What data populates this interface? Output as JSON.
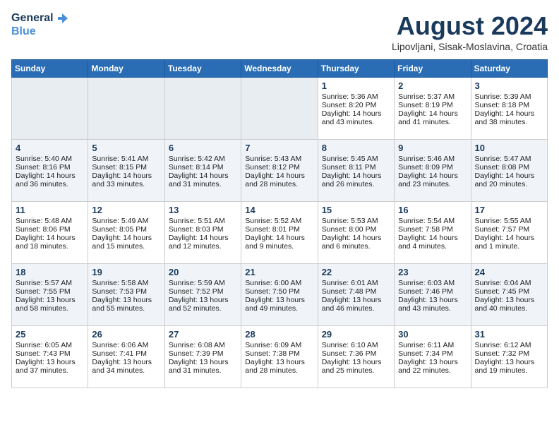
{
  "header": {
    "logo_line1": "General",
    "logo_line2": "Blue",
    "month_year": "August 2024",
    "location": "Lipovljani, Sisak-Moslavina, Croatia"
  },
  "days_of_week": [
    "Sunday",
    "Monday",
    "Tuesday",
    "Wednesday",
    "Thursday",
    "Friday",
    "Saturday"
  ],
  "weeks": [
    [
      {
        "day": "",
        "info": ""
      },
      {
        "day": "",
        "info": ""
      },
      {
        "day": "",
        "info": ""
      },
      {
        "day": "",
        "info": ""
      },
      {
        "day": "1",
        "info": "Sunrise: 5:36 AM\nSunset: 8:20 PM\nDaylight: 14 hours\nand 43 minutes."
      },
      {
        "day": "2",
        "info": "Sunrise: 5:37 AM\nSunset: 8:19 PM\nDaylight: 14 hours\nand 41 minutes."
      },
      {
        "day": "3",
        "info": "Sunrise: 5:39 AM\nSunset: 8:18 PM\nDaylight: 14 hours\nand 38 minutes."
      }
    ],
    [
      {
        "day": "4",
        "info": "Sunrise: 5:40 AM\nSunset: 8:16 PM\nDaylight: 14 hours\nand 36 minutes."
      },
      {
        "day": "5",
        "info": "Sunrise: 5:41 AM\nSunset: 8:15 PM\nDaylight: 14 hours\nand 33 minutes."
      },
      {
        "day": "6",
        "info": "Sunrise: 5:42 AM\nSunset: 8:14 PM\nDaylight: 14 hours\nand 31 minutes."
      },
      {
        "day": "7",
        "info": "Sunrise: 5:43 AM\nSunset: 8:12 PM\nDaylight: 14 hours\nand 28 minutes."
      },
      {
        "day": "8",
        "info": "Sunrise: 5:45 AM\nSunset: 8:11 PM\nDaylight: 14 hours\nand 26 minutes."
      },
      {
        "day": "9",
        "info": "Sunrise: 5:46 AM\nSunset: 8:09 PM\nDaylight: 14 hours\nand 23 minutes."
      },
      {
        "day": "10",
        "info": "Sunrise: 5:47 AM\nSunset: 8:08 PM\nDaylight: 14 hours\nand 20 minutes."
      }
    ],
    [
      {
        "day": "11",
        "info": "Sunrise: 5:48 AM\nSunset: 8:06 PM\nDaylight: 14 hours\nand 18 minutes."
      },
      {
        "day": "12",
        "info": "Sunrise: 5:49 AM\nSunset: 8:05 PM\nDaylight: 14 hours\nand 15 minutes."
      },
      {
        "day": "13",
        "info": "Sunrise: 5:51 AM\nSunset: 8:03 PM\nDaylight: 14 hours\nand 12 minutes."
      },
      {
        "day": "14",
        "info": "Sunrise: 5:52 AM\nSunset: 8:01 PM\nDaylight: 14 hours\nand 9 minutes."
      },
      {
        "day": "15",
        "info": "Sunrise: 5:53 AM\nSunset: 8:00 PM\nDaylight: 14 hours\nand 6 minutes."
      },
      {
        "day": "16",
        "info": "Sunrise: 5:54 AM\nSunset: 7:58 PM\nDaylight: 14 hours\nand 4 minutes."
      },
      {
        "day": "17",
        "info": "Sunrise: 5:55 AM\nSunset: 7:57 PM\nDaylight: 14 hours\nand 1 minute."
      }
    ],
    [
      {
        "day": "18",
        "info": "Sunrise: 5:57 AM\nSunset: 7:55 PM\nDaylight: 13 hours\nand 58 minutes."
      },
      {
        "day": "19",
        "info": "Sunrise: 5:58 AM\nSunset: 7:53 PM\nDaylight: 13 hours\nand 55 minutes."
      },
      {
        "day": "20",
        "info": "Sunrise: 5:59 AM\nSunset: 7:52 PM\nDaylight: 13 hours\nand 52 minutes."
      },
      {
        "day": "21",
        "info": "Sunrise: 6:00 AM\nSunset: 7:50 PM\nDaylight: 13 hours\nand 49 minutes."
      },
      {
        "day": "22",
        "info": "Sunrise: 6:01 AM\nSunset: 7:48 PM\nDaylight: 13 hours\nand 46 minutes."
      },
      {
        "day": "23",
        "info": "Sunrise: 6:03 AM\nSunset: 7:46 PM\nDaylight: 13 hours\nand 43 minutes."
      },
      {
        "day": "24",
        "info": "Sunrise: 6:04 AM\nSunset: 7:45 PM\nDaylight: 13 hours\nand 40 minutes."
      }
    ],
    [
      {
        "day": "25",
        "info": "Sunrise: 6:05 AM\nSunset: 7:43 PM\nDaylight: 13 hours\nand 37 minutes."
      },
      {
        "day": "26",
        "info": "Sunrise: 6:06 AM\nSunset: 7:41 PM\nDaylight: 13 hours\nand 34 minutes."
      },
      {
        "day": "27",
        "info": "Sunrise: 6:08 AM\nSunset: 7:39 PM\nDaylight: 13 hours\nand 31 minutes."
      },
      {
        "day": "28",
        "info": "Sunrise: 6:09 AM\nSunset: 7:38 PM\nDaylight: 13 hours\nand 28 minutes."
      },
      {
        "day": "29",
        "info": "Sunrise: 6:10 AM\nSunset: 7:36 PM\nDaylight: 13 hours\nand 25 minutes."
      },
      {
        "day": "30",
        "info": "Sunrise: 6:11 AM\nSunset: 7:34 PM\nDaylight: 13 hours\nand 22 minutes."
      },
      {
        "day": "31",
        "info": "Sunrise: 6:12 AM\nSunset: 7:32 PM\nDaylight: 13 hours\nand 19 minutes."
      }
    ]
  ]
}
